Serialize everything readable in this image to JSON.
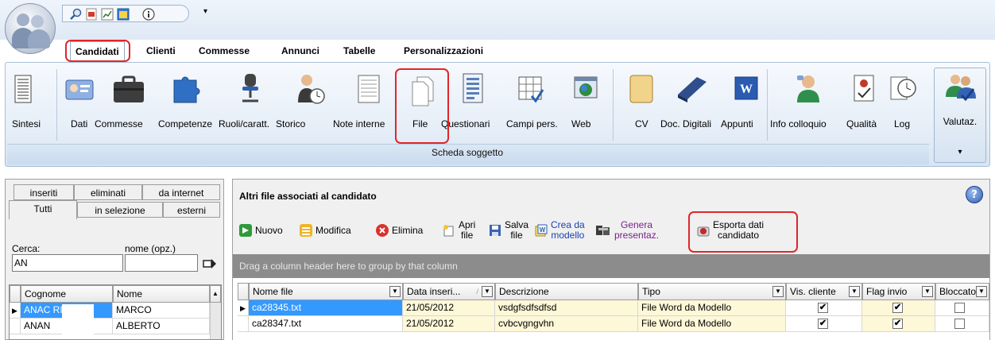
{
  "tabs": [
    {
      "label": "Candidati",
      "active": true
    },
    {
      "label": "Clienti"
    },
    {
      "label": "Commesse"
    },
    {
      "label": "Annunci"
    },
    {
      "label": "Tabelle"
    },
    {
      "label": "Personalizzazioni"
    }
  ],
  "quick_access": {
    "icons": [
      "search-icon",
      "pdf-icon",
      "report-icon",
      "window-icon",
      "info-icon"
    ],
    "more_glyph": "▾"
  },
  "ribbon": {
    "items": [
      {
        "label": "Sintesi",
        "icon": "summary-icon"
      },
      {
        "label": "Dati",
        "icon": "id-card-icon"
      },
      {
        "label": "Commesse",
        "icon": "briefcase-icon"
      },
      {
        "label": "Competenze",
        "icon": "puzzle-icon"
      },
      {
        "label": "Ruoli/caratt.",
        "icon": "chair-icon"
      },
      {
        "label": "Storico",
        "icon": "history-icon"
      },
      {
        "label": "Note interne",
        "icon": "notes-icon"
      },
      {
        "label": "File",
        "icon": "file-icon",
        "highlighted": true
      },
      {
        "label": "Questionari",
        "icon": "questionnaire-icon"
      },
      {
        "label": "Campi pers.",
        "icon": "custom-fields-icon"
      },
      {
        "label": "Web",
        "icon": "web-icon"
      },
      {
        "label": "CV",
        "icon": "scroll-icon"
      },
      {
        "label": "Doc. Digitali",
        "icon": "scanner-icon"
      },
      {
        "label": "Appunti",
        "icon": "word-icon"
      },
      {
        "label": "Info colloquio",
        "icon": "interview-icon"
      },
      {
        "label": "Qualità",
        "icon": "quality-icon"
      },
      {
        "label": "Log",
        "icon": "log-icon"
      }
    ],
    "group_label": "Scheda soggetto",
    "valutaz_label": "Valutaz.",
    "valutaz_arrow": "▾"
  },
  "left_panel": {
    "tabs_row1": [
      "inseriti",
      "eliminati",
      "da internet"
    ],
    "tabs_row2": [
      "Tutti",
      "in selezione",
      "esterni"
    ],
    "search_label": "Cerca:",
    "name_label": "nome (opz.)",
    "search_value": "AN",
    "name_value": "",
    "columns": [
      "Cognome",
      "Nome"
    ],
    "rows": [
      {
        "cognome": "ANAC  RIO",
        "nome": "MARCO",
        "selected": true
      },
      {
        "cognome": "ANAN",
        "nome": "ALBERTO"
      }
    ]
  },
  "right_panel": {
    "title": "Altri file associati al candidato",
    "toolbar": {
      "nuovo": "Nuovo",
      "modifica": "Modifica",
      "elimina": "Elimina",
      "apri_1": "Apri",
      "apri_2": "file",
      "salva_1": "Salva",
      "salva_2": "file",
      "crea_1": "Crea da",
      "crea_2": "modello",
      "genera_1": "Genera",
      "genera_2": "presentaz.",
      "esporta_1": "Esporta dati",
      "esporta_2": "candidato"
    },
    "group_hint": "Drag a column header here to group by that column",
    "columns": [
      "Nome file",
      "Data inseri...",
      "Descrizione",
      "Tipo",
      "Vis. cliente",
      "Flag invio",
      "Bloccato"
    ],
    "rows": [
      {
        "nome_file": "ca28345.txt",
        "data": "21/05/2012",
        "descrizione": "vsdgfsdfsdfsd",
        "tipo": "File Word da Modello",
        "vis_cliente": true,
        "flag_invio": true,
        "bloccato": false,
        "selected": true
      },
      {
        "nome_file": "ca28347.txt",
        "data": "21/05/2012",
        "descrizione": "cvbcvgngvhn",
        "tipo": "File Word da Modello",
        "vis_cliente": true,
        "flag_invio": true,
        "bloccato": false
      }
    ]
  },
  "colors": {
    "highlight": "#e0262b",
    "selection": "#3399ff",
    "link_purple": "#7a1f8c",
    "link_blue": "#1a3fb0"
  }
}
